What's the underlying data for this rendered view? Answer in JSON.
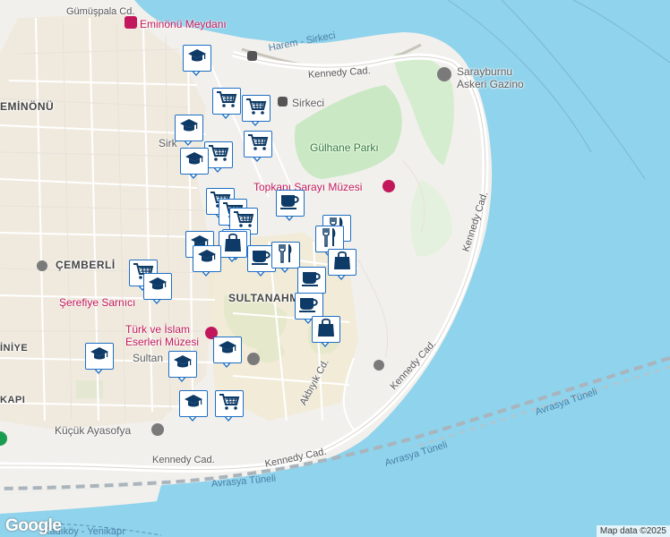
{
  "labels": {
    "gumuspala": "Gümüşpala Cd.",
    "eminonu_meydani": "Eminönü Meydanı",
    "harem_sirkeci": "Harem - Sirkeci",
    "kennedy_top": "Kennedy Cad.",
    "sarayburnu": "Sarayburnu",
    "askeri_gazino": "Askeri Gazino",
    "eminonu": "EMİNÖNÜ",
    "sirkeci": "Sirkeci",
    "sirk": "Sirk",
    "gulhane": "Gülhane Parkı",
    "topkapi": "Topkapı Sarayı Müzesi",
    "kennedy_right": "Kennedy Cad.",
    "cemberli": "ÇEMBERLİ",
    "sultanahmet": "SULTANAHMET",
    "serefiye": "Şerefiye Sarnıcı",
    "turk_islam_1": "Türk ve İslam",
    "turk_islam_2": "Eserleri Müzesi",
    "sultan": "Sultan",
    "iniye": "İNİYE",
    "kapi": "KAPI",
    "akbiyik": "Akbıyık Cd.",
    "kennedy_mid": "Kennedy Cad.",
    "avrasya_right": "Avrasya Tüneli",
    "kennedy_bottom": "Kennedy Cad.",
    "avrasya_mid": "Avrasya Tüneli",
    "avrasya_bottom": "Avrasya Tüneli",
    "kucuk_ayasofya": "Küçük Ayasofya",
    "kennedy_left": "Kennedy Cad.",
    "kadikoy": "Kadıköy - Yenikapı"
  },
  "google": "Google",
  "attribution": "Map data ©2025",
  "colors": {
    "water": "#8fd3ec",
    "land": "#f2f0ec",
    "park": "#c9e8c3",
    "marker_border": "#1e6fc4",
    "poi": "#c2185b"
  },
  "markers": [
    {
      "icon": "school-icon"
    },
    {
      "icon": "cart-icon"
    },
    {
      "icon": "cart-icon"
    },
    {
      "icon": "school-icon"
    },
    {
      "icon": "cart-icon"
    },
    {
      "icon": "cart-icon"
    },
    {
      "icon": "school-icon"
    },
    {
      "icon": "cart-icon"
    },
    {
      "icon": "cart-icon"
    },
    {
      "icon": "cart-icon"
    },
    {
      "icon": "cart-icon"
    },
    {
      "icon": "cup-icon"
    },
    {
      "icon": "restaurant-icon"
    },
    {
      "icon": "restaurant-icon"
    },
    {
      "icon": "shopping-bag-icon"
    },
    {
      "icon": "school-icon"
    },
    {
      "icon": "school-icon"
    },
    {
      "icon": "cup-icon"
    },
    {
      "icon": "restaurant-icon"
    },
    {
      "icon": "shopping-bag-icon"
    },
    {
      "icon": "cart-icon"
    },
    {
      "icon": "school-icon"
    },
    {
      "icon": "cup-icon"
    },
    {
      "icon": "cup-icon"
    },
    {
      "icon": "shopping-bag-icon"
    },
    {
      "icon": "school-icon"
    },
    {
      "icon": "school-icon"
    },
    {
      "icon": "school-icon"
    },
    {
      "icon": "school-icon"
    },
    {
      "icon": "cart-icon"
    }
  ]
}
